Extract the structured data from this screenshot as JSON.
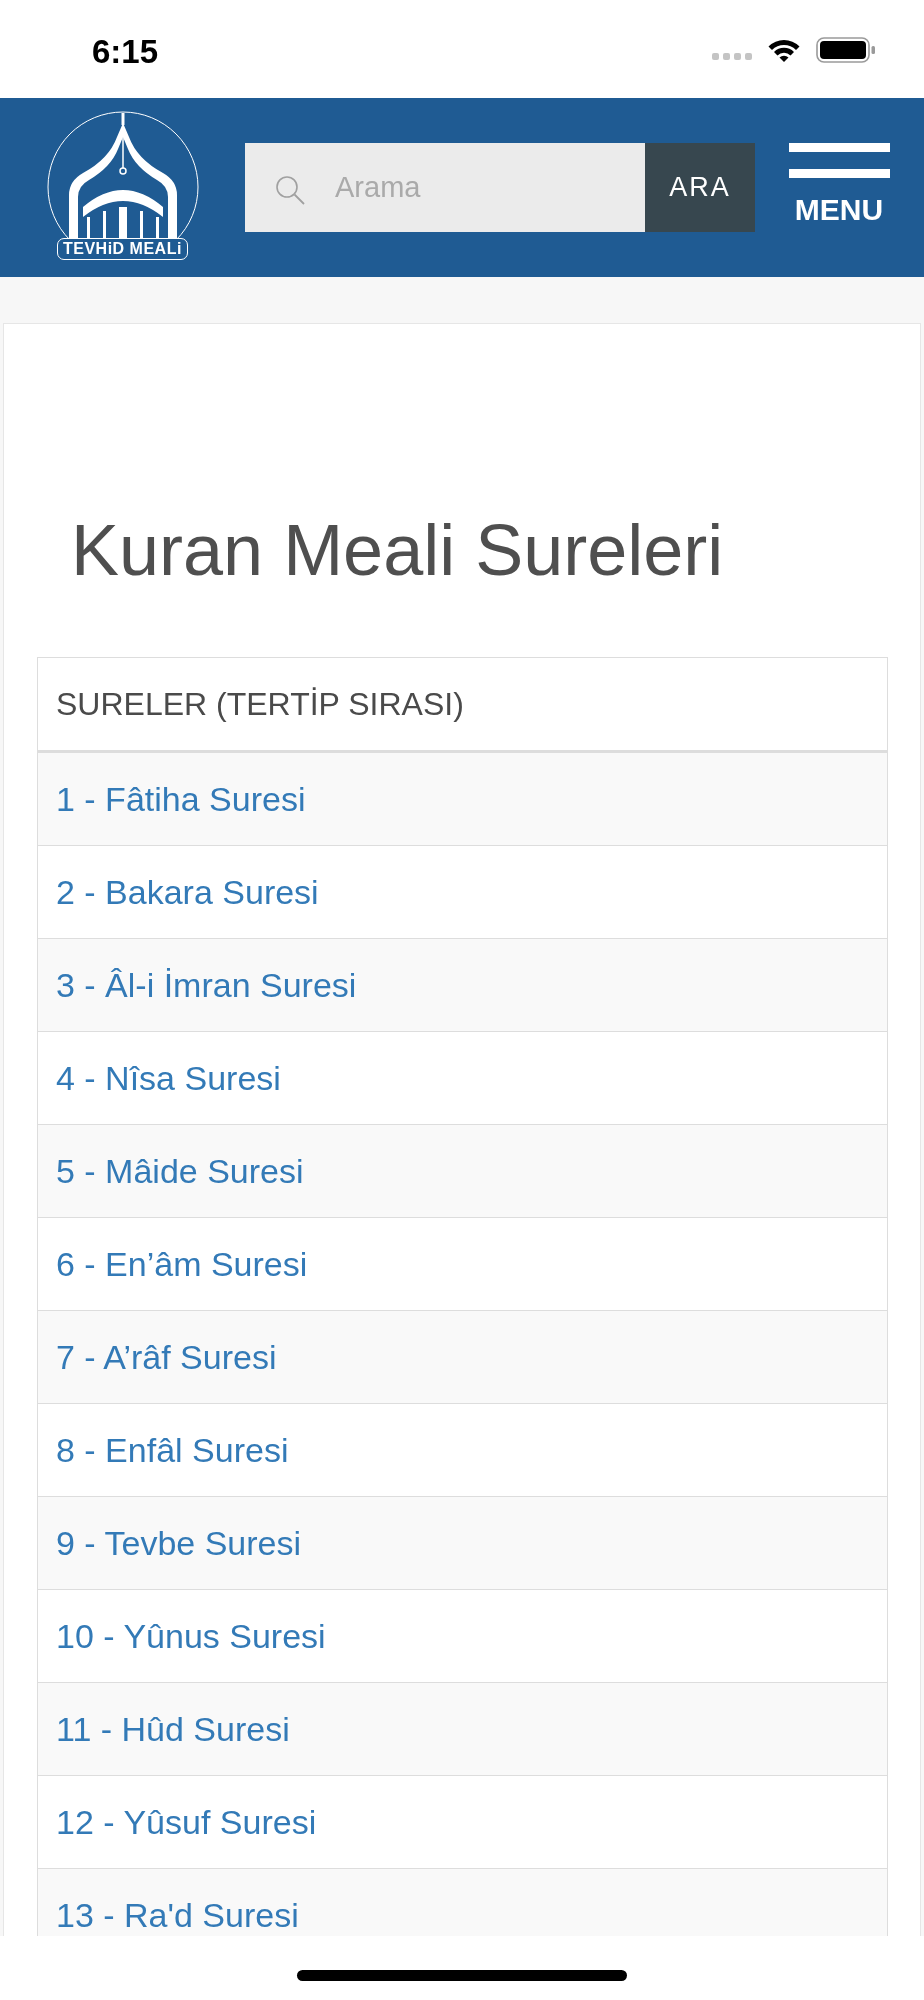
{
  "status_bar": {
    "time": "6:15"
  },
  "header": {
    "logo_label": "TEVHiD MEALi",
    "search": {
      "placeholder": "Arama",
      "button": "ARA"
    },
    "menu": "MENU"
  },
  "page_title": "Kuran Meali Sureleri",
  "table": {
    "columns": [
      "SURELER (TERTİP SIRASI)"
    ],
    "rows": [
      "1 - Fâtiha Suresi",
      "2 - Bakara Suresi",
      "3 - Âl-i İmran Suresi",
      "4 - Nîsa Suresi",
      "5 - Mâide Suresi",
      "6 - En’âm Suresi",
      "7 - A’râf Suresi",
      "8 - Enfâl Suresi",
      "9 - Tevbe Suresi",
      "10 - Yûnus Suresi",
      "11 - Hûd Suresi",
      "12 - Yûsuf Suresi",
      "13 - Ra'd Suresi"
    ]
  }
}
